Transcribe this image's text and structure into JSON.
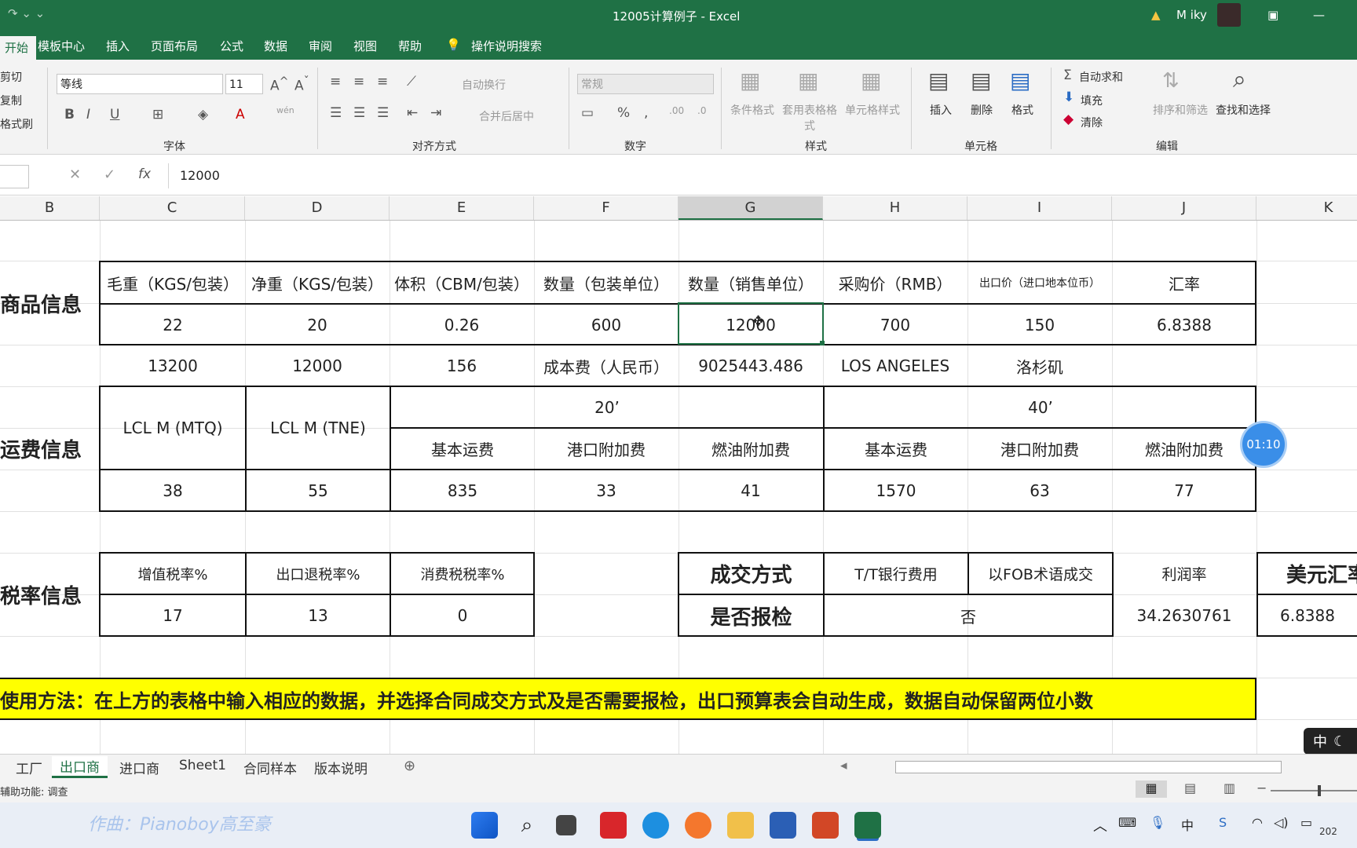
{
  "title_bar": {
    "title": "12005计算例子  -  Excel",
    "user": "M iky"
  },
  "ribbon_tabs": [
    "开始",
    "模板中心",
    "插入",
    "页面布局",
    "公式",
    "数据",
    "审阅",
    "视图",
    "帮助",
    "操作说明搜索"
  ],
  "clipboard": {
    "cut": "剪切",
    "copy": "复制",
    "painter": "格式刷"
  },
  "font": {
    "name": "等线",
    "size": "11",
    "group": "字体"
  },
  "align": {
    "wrap": "自动换行",
    "merge": "合并后居中",
    "group": "对齐方式"
  },
  "number": {
    "format": "常规",
    "group": "数字"
  },
  "styles": {
    "cond": "条件格式",
    "table": "套用表格格式",
    "cell": "单元格样式",
    "group": "样式"
  },
  "cells": {
    "insert": "插入",
    "delete": "删除",
    "format": "格式",
    "group": "单元格"
  },
  "editing": {
    "autosum": "自动求和",
    "fill": "填充",
    "clear": "清除",
    "sort": "排序和筛选",
    "find": "查找和选择",
    "group": "编辑"
  },
  "formula": {
    "fx": "fx",
    "value": "12000"
  },
  "columns": [
    "B",
    "C",
    "D",
    "E",
    "F",
    "G",
    "H",
    "I",
    "J",
    "K"
  ],
  "sheet": {
    "goods_label": "商品信息",
    "goods_headers": [
      "毛重（KGS/包装）",
      "净重（KGS/包装）",
      "体积（CBM/包装）",
      "数量（包装单位）",
      "数量（销售单位）",
      "采购价（RMB）",
      "出口价（进口地本位币）",
      "汇率"
    ],
    "goods_values": [
      "22",
      "20",
      "0.26",
      "600",
      "12000",
      "700",
      "150",
      "6.8388"
    ],
    "row3": [
      "13200",
      "12000",
      "156",
      "成本费（人民币）",
      "9025443.486",
      "LOS ANGELES",
      "洛杉矶"
    ],
    "freight_label": "运费信息",
    "lcl_mtq": "LCL M (MTQ)",
    "lcl_tne": "LCL M (TNE)",
    "c20": "20’",
    "c40": "40’",
    "freight_sub": [
      "基本运费",
      "港口附加费",
      "燃油附加费",
      "基本运费",
      "港口附加费",
      "燃油附加费"
    ],
    "freight_values": [
      "38",
      "55",
      "835",
      "33",
      "41",
      "1570",
      "63",
      "77"
    ],
    "tax_label": "税率信息",
    "tax_headers": [
      "增值税率%",
      "出口退税率%",
      "消费税税率%"
    ],
    "tax_values": [
      "17",
      "13",
      "0"
    ],
    "deal_label": "成交方式",
    "deal_items": [
      "T/T银行费用",
      "以FOB术语成交",
      "利润率",
      "美元汇率"
    ],
    "inspect_label": "是否报检",
    "inspect_value": "否",
    "profit": "34.2630761",
    "usd_rate": "6.8388",
    "usage": "使用方法：在上方的表格中输入相应的数据，并选择合同成交方式及是否需要报检，出口预算表会自动生成，数据自动保留两位小数"
  },
  "timer": "01:10",
  "ime": "中",
  "sheet_tabs": [
    "工厂",
    "出口商",
    "进口商",
    "Sheet1",
    "合同样本",
    "版本说明"
  ],
  "status": "辅助功能: 调查",
  "watermark": "作曲：Pianoboy高至豪",
  "clock": "202"
}
